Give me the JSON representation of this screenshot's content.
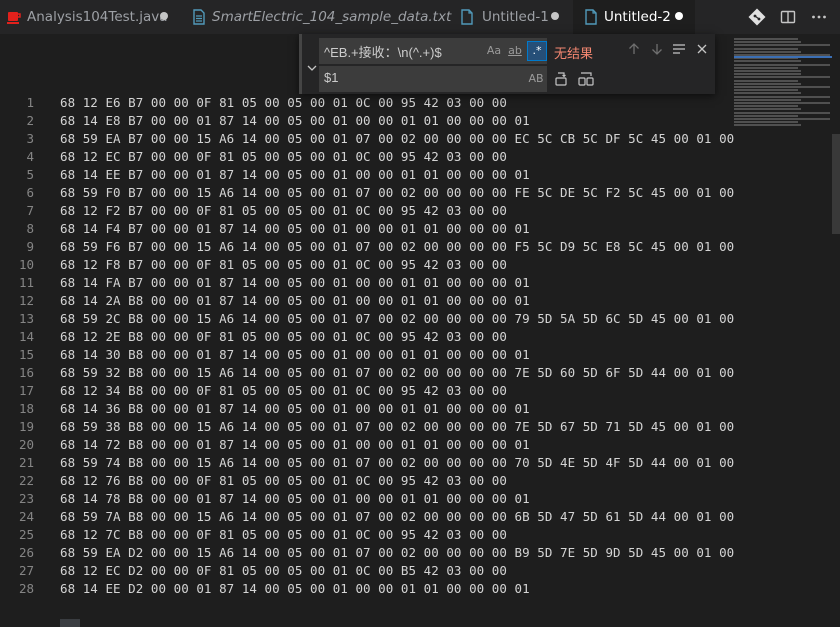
{
  "tabs": [
    {
      "label": "Analysis104Test.java",
      "icon": "java-icon",
      "modified": true,
      "active": false,
      "italic": false
    },
    {
      "label": "SmartElectric_104_sample_data.txt",
      "icon": "file-icon",
      "modified": false,
      "active": false,
      "italic": true
    },
    {
      "label": "Untitled-1",
      "icon": "file-icon",
      "modified": true,
      "active": false,
      "italic": false
    },
    {
      "label": "Untitled-2",
      "icon": "file-icon",
      "modified": true,
      "active": true,
      "italic": false
    }
  ],
  "find_widget": {
    "search_value": "^EB.+接收：\\n(^.+)$",
    "replace_value": "$1",
    "match_case_label": "Aa",
    "whole_word_label": "ab",
    "regex_label": ".*",
    "preserve_case_label": "AB",
    "no_results": "无结果"
  },
  "lines": [
    {
      "n": "1",
      "text": "68 12 E6 B7 00 00 0F 81 05 00 05 00 01 0C 00 95 42 03 00 00"
    },
    {
      "n": "2",
      "text": "68 14 E8 B7 00 00 01 87 14 00 05 00 01 00 00 01 01 00 00 00 01"
    },
    {
      "n": "3",
      "text": "68 59 EA B7 00 00 15 A6 14 00 05 00 01 07 00 02 00 00 00 00 EC 5C CB 5C DF 5C 45 00 01 00"
    },
    {
      "n": "4",
      "text": "68 12 EC B7 00 00 0F 81 05 00 05 00 01 0C 00 95 42 03 00 00"
    },
    {
      "n": "5",
      "text": "68 14 EE B7 00 00 01 87 14 00 05 00 01 00 00 01 01 00 00 00 01"
    },
    {
      "n": "6",
      "text": "68 59 F0 B7 00 00 15 A6 14 00 05 00 01 07 00 02 00 00 00 00 FE 5C DE 5C F2 5C 45 00 01 00"
    },
    {
      "n": "7",
      "text": "68 12 F2 B7 00 00 0F 81 05 00 05 00 01 0C 00 95 42 03 00 00"
    },
    {
      "n": "8",
      "text": "68 14 F4 B7 00 00 01 87 14 00 05 00 01 00 00 01 01 00 00 00 01"
    },
    {
      "n": "9",
      "text": "68 59 F6 B7 00 00 15 A6 14 00 05 00 01 07 00 02 00 00 00 00 F5 5C D9 5C E8 5C 45 00 01 00"
    },
    {
      "n": "10",
      "text": "68 12 F8 B7 00 00 0F 81 05 00 05 00 01 0C 00 95 42 03 00 00"
    },
    {
      "n": "11",
      "text": "68 14 FA B7 00 00 01 87 14 00 05 00 01 00 00 01 01 00 00 00 01"
    },
    {
      "n": "12",
      "text": "68 14 2A B8 00 00 01 87 14 00 05 00 01 00 00 01 01 00 00 00 01"
    },
    {
      "n": "13",
      "text": "68 59 2C B8 00 00 15 A6 14 00 05 00 01 07 00 02 00 00 00 00 79 5D 5A 5D 6C 5D 45 00 01 00"
    },
    {
      "n": "14",
      "text": "68 12 2E B8 00 00 0F 81 05 00 05 00 01 0C 00 95 42 03 00 00"
    },
    {
      "n": "15",
      "text": "68 14 30 B8 00 00 01 87 14 00 05 00 01 00 00 01 01 00 00 00 01"
    },
    {
      "n": "16",
      "text": "68 59 32 B8 00 00 15 A6 14 00 05 00 01 07 00 02 00 00 00 00 7E 5D 60 5D 6F 5D 44 00 01 00"
    },
    {
      "n": "17",
      "text": "68 12 34 B8 00 00 0F 81 05 00 05 00 01 0C 00 95 42 03 00 00"
    },
    {
      "n": "18",
      "text": "68 14 36 B8 00 00 01 87 14 00 05 00 01 00 00 01 01 00 00 00 01"
    },
    {
      "n": "19",
      "text": "68 59 38 B8 00 00 15 A6 14 00 05 00 01 07 00 02 00 00 00 00 7E 5D 67 5D 71 5D 45 00 01 00"
    },
    {
      "n": "20",
      "text": "68 14 72 B8 00 00 01 87 14 00 05 00 01 00 00 01 01 00 00 00 01"
    },
    {
      "n": "21",
      "text": "68 59 74 B8 00 00 15 A6 14 00 05 00 01 07 00 02 00 00 00 00 70 5D 4E 5D 4F 5D 44 00 01 00"
    },
    {
      "n": "22",
      "text": "68 12 76 B8 00 00 0F 81 05 00 05 00 01 0C 00 95 42 03 00 00"
    },
    {
      "n": "23",
      "text": "68 14 78 B8 00 00 01 87 14 00 05 00 01 00 00 01 01 00 00 00 01"
    },
    {
      "n": "24",
      "text": "68 59 7A B8 00 00 15 A6 14 00 05 00 01 07 00 02 00 00 00 00 6B 5D 47 5D 61 5D 44 00 01 00"
    },
    {
      "n": "25",
      "text": "68 12 7C B8 00 00 0F 81 05 00 05 00 01 0C 00 95 42 03 00 00"
    },
    {
      "n": "26",
      "text": "68 59 EA D2 00 00 15 A6 14 00 05 00 01 07 00 02 00 00 00 00 B9 5D 7E 5D 9D 5D 45 00 01 00"
    },
    {
      "n": "27",
      "text": "68 12 EC D2 00 00 0F 81 05 00 05 00 01 0C 00 B5 42 03 00 00"
    },
    {
      "n": "28",
      "text": "68 14 EE D2 00 00 01 87 14 00 05 00 01 00 00 01 01 00 00 00 01"
    }
  ]
}
